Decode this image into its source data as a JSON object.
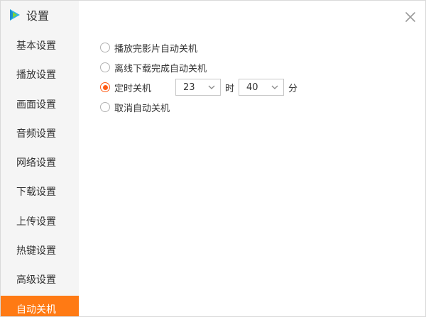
{
  "window": {
    "title": "设置"
  },
  "sidebar": {
    "items": [
      {
        "label": "基本设置"
      },
      {
        "label": "播放设置"
      },
      {
        "label": "画面设置"
      },
      {
        "label": "音频设置"
      },
      {
        "label": "网络设置"
      },
      {
        "label": "下载设置"
      },
      {
        "label": "上传设置"
      },
      {
        "label": "热键设置"
      },
      {
        "label": "高级设置"
      },
      {
        "label": "自动关机",
        "active": true
      }
    ]
  },
  "content": {
    "options": [
      {
        "label": "播放完影片自动关机",
        "checked": false
      },
      {
        "label": "离线下载完成自动关机",
        "checked": false
      },
      {
        "label": "定时关机",
        "checked": true
      },
      {
        "label": "取消自动关机",
        "checked": false
      }
    ],
    "timer": {
      "hour_value": "23",
      "hour_unit": "时",
      "minute_value": "40",
      "minute_unit": "分"
    }
  },
  "colors": {
    "accent": "#ff7a14",
    "radio_checked": "#ff5b14",
    "sidebar_bg": "#f5f5f5"
  },
  "icons": {
    "logo": "play-logo-icon",
    "close": "close-icon",
    "dropdown": "chevron-down-icon"
  }
}
